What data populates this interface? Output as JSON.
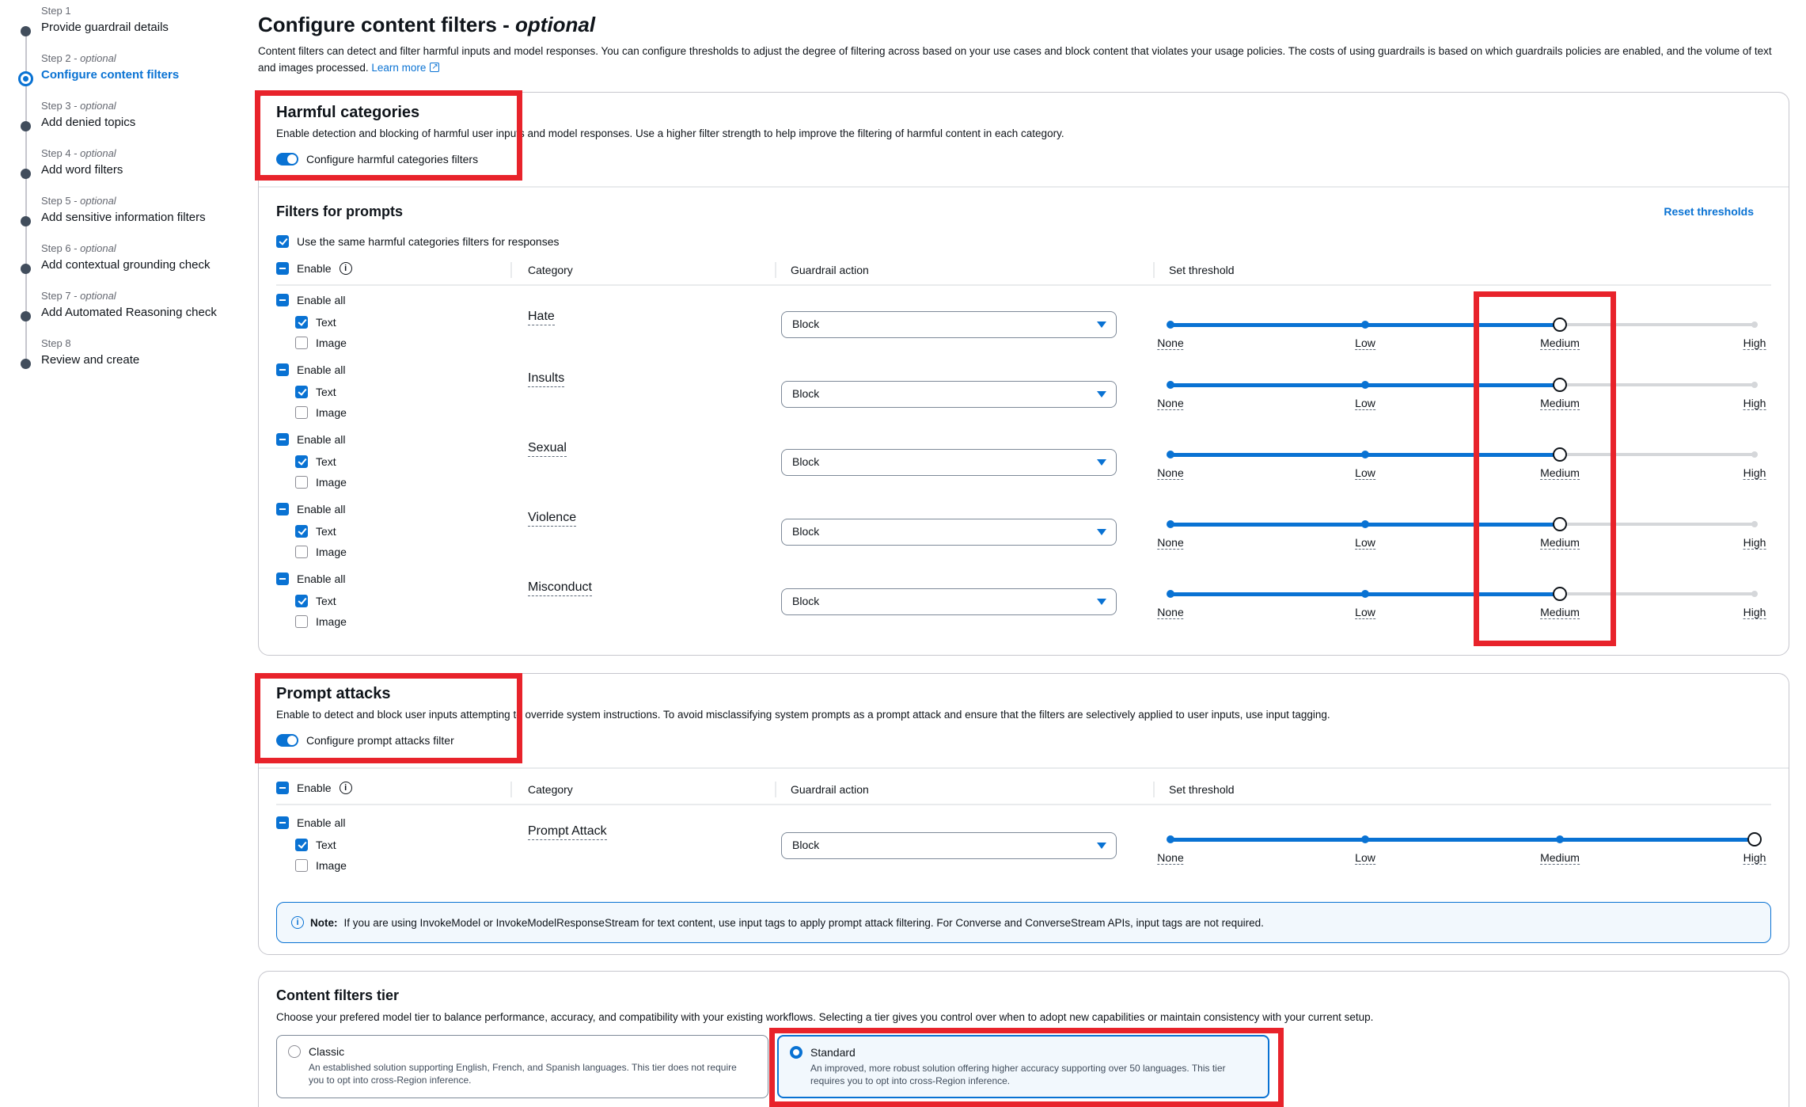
{
  "steps": [
    {
      "num": "Step 1",
      "optional": "",
      "name": "Provide guardrail details"
    },
    {
      "num": "Step 2 -",
      "optional": "optional",
      "name": "Configure content filters"
    },
    {
      "num": "Step 3 -",
      "optional": "optional",
      "name": "Add denied topics"
    },
    {
      "num": "Step 4 -",
      "optional": "optional",
      "name": "Add word filters"
    },
    {
      "num": "Step 5 -",
      "optional": "optional",
      "name": "Add sensitive information filters"
    },
    {
      "num": "Step 6 -",
      "optional": "optional",
      "name": "Add contextual grounding check"
    },
    {
      "num": "Step 7 -",
      "optional": "optional",
      "name": "Add Automated Reasoning check"
    },
    {
      "num": "Step 8",
      "optional": "",
      "name": "Review and create"
    }
  ],
  "active_step": 2,
  "page": {
    "title": "Configure content filters -",
    "title_optional": "optional",
    "description": "Content filters can detect and filter harmful inputs and model responses. You can configure thresholds to adjust the degree of filtering across based on your use cases and block content that violates your usage policies. The costs of using guardrails is based on which guardrails policies are enabled, and the volume of text and images processed.",
    "learn_more": "Learn more"
  },
  "harmful": {
    "title": "Harmful categories",
    "description": "Enable detection and blocking of harmful user inputs and model responses. Use a higher filter strength to help improve the filtering of harmful content in each category.",
    "toggle_label": "Configure harmful categories filters",
    "filters_title": "Filters for prompts",
    "reset_label": "Reset thresholds",
    "same_filters_label": "Use the same harmful categories filters for responses",
    "columns": {
      "enable": "Enable",
      "category": "Category",
      "action": "Guardrail action",
      "threshold": "Set threshold"
    },
    "rows": [
      {
        "enable_all": "Enable all",
        "text": "Text",
        "image": "Image",
        "category": "Hate",
        "action": "Block",
        "threshold": "Medium"
      },
      {
        "enable_all": "Enable all",
        "text": "Text",
        "image": "Image",
        "category": "Insults",
        "action": "Block",
        "threshold": "Medium"
      },
      {
        "enable_all": "Enable all",
        "text": "Text",
        "image": "Image",
        "category": "Sexual",
        "action": "Block",
        "threshold": "Medium"
      },
      {
        "enable_all": "Enable all",
        "text": "Text",
        "image": "Image",
        "category": "Violence",
        "action": "Block",
        "threshold": "Medium"
      },
      {
        "enable_all": "Enable all",
        "text": "Text",
        "image": "Image",
        "category": "Misconduct",
        "action": "Block",
        "threshold": "Medium"
      }
    ]
  },
  "threshold_levels": [
    "None",
    "Low",
    "Medium",
    "High"
  ],
  "prompt": {
    "title": "Prompt attacks",
    "description": "Enable to detect and block user inputs attempting to override system instructions. To avoid misclassifying system prompts as a prompt attack and ensure that the filters are selectively applied to user inputs, use input tagging.",
    "toggle_label": "Configure prompt attacks filter",
    "columns": {
      "enable": "Enable",
      "category": "Category",
      "action": "Guardrail action",
      "threshold": "Set threshold"
    },
    "row": {
      "enable_all": "Enable all",
      "text": "Text",
      "image": "Image",
      "category": "Prompt Attack",
      "action": "Block",
      "threshold": "High"
    },
    "note_label": "Note:",
    "note_text": "If you are using InvokeModel or InvokeModelResponseStream for text content, use input tags to apply prompt attack filtering. For Converse and ConverseStream APIs, input tags are not required."
  },
  "tier": {
    "title": "Content filters tier",
    "description": "Choose your prefered model tier to balance performance, accuracy, and compatibility with your existing workflows. Selecting a tier gives you control over when to adopt new capabilities or maintain consistency with your current setup.",
    "options": [
      {
        "name": "Classic",
        "desc": "An established solution supporting English, French, and Spanish languages. This tier does not require you to opt into cross-Region inference.",
        "selected": false
      },
      {
        "name": "Standard",
        "desc": "An improved, more robust solution offering higher accuracy supporting over 50 languages. This tier requires you to opt into cross-Region inference.",
        "selected": true
      }
    ]
  },
  "colors": {
    "accent": "#0972d3",
    "highlight": "#e8232b"
  }
}
